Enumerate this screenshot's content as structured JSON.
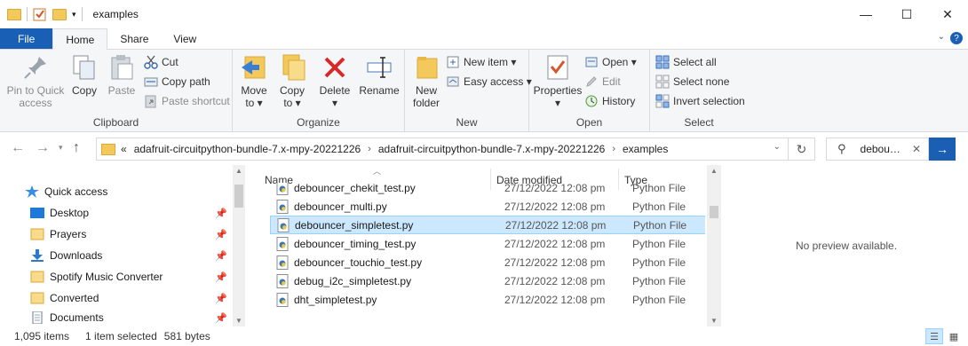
{
  "window": {
    "title": "examples",
    "controls": {
      "minimize": "—",
      "maximize": "☐",
      "close": "✕"
    }
  },
  "tabs": [
    {
      "label": "File"
    },
    {
      "label": "Home"
    },
    {
      "label": "Share"
    },
    {
      "label": "View"
    }
  ],
  "ribbon": {
    "clipboard": {
      "label": "Clipboard",
      "pin": [
        "Pin to Quick",
        "access"
      ],
      "copy": "Copy",
      "paste": "Paste",
      "cut": "Cut",
      "copy_path": "Copy path",
      "paste_shortcut": "Paste shortcut"
    },
    "organize": {
      "label": "Organize",
      "move": [
        "Move",
        "to ▾"
      ],
      "copy": [
        "Copy",
        "to ▾"
      ],
      "delete": [
        "Delete",
        "▾"
      ],
      "rename": "Rename"
    },
    "new": {
      "label": "New",
      "folder": [
        "New",
        "folder"
      ],
      "new_item": "New item ▾",
      "easy_access": "Easy access ▾"
    },
    "open": {
      "label": "Open",
      "properties": [
        "Properties",
        "▾"
      ],
      "open": "Open ▾",
      "edit": "Edit",
      "history": "History"
    },
    "select": {
      "label": "Select",
      "select_all": "Select all",
      "select_none": "Select none",
      "invert": "Invert selection"
    }
  },
  "address": {
    "prefix": "«",
    "crumbs": [
      "adafruit-circuitpython-bundle-7.x-mpy-20221226",
      "adafruit-circuitpython-bundle-7.x-mpy-20221226",
      "examples"
    ],
    "search_text": "debou…"
  },
  "nav": {
    "items": [
      {
        "label": "Quick access",
        "icon": "star-icon"
      },
      {
        "label": "Desktop",
        "icon": "desktop-icon"
      },
      {
        "label": "Prayers",
        "icon": "folder-icon"
      },
      {
        "label": "Downloads",
        "icon": "download-icon"
      },
      {
        "label": "Spotify Music Converter",
        "icon": "folder-icon"
      },
      {
        "label": "Converted",
        "icon": "folder-icon"
      },
      {
        "label": "Documents",
        "icon": "documents-icon"
      }
    ]
  },
  "columns": {
    "name": "Name",
    "date": "Date modified",
    "type": "Type"
  },
  "files": [
    {
      "name": "debouncer_chekit_test.py",
      "date": "27/12/2022 12:08 pm",
      "type": "Python File"
    },
    {
      "name": "debouncer_multi.py",
      "date": "27/12/2022 12:08 pm",
      "type": "Python File"
    },
    {
      "name": "debouncer_simpletest.py",
      "date": "27/12/2022 12:08 pm",
      "type": "Python File"
    },
    {
      "name": "debouncer_timing_test.py",
      "date": "27/12/2022 12:08 pm",
      "type": "Python File"
    },
    {
      "name": "debouncer_touchio_test.py",
      "date": "27/12/2022 12:08 pm",
      "type": "Python File"
    },
    {
      "name": "debug_i2c_simpletest.py",
      "date": "27/12/2022 12:08 pm",
      "type": "Python File"
    },
    {
      "name": "dht_simpletest.py",
      "date": "27/12/2022 12:08 pm",
      "type": "Python File"
    }
  ],
  "preview": {
    "message": "No preview available."
  },
  "status": {
    "count": "1,095 items",
    "selected": "1 item selected",
    "size": "581 bytes"
  },
  "colors": {
    "accent": "#1a5fb4",
    "selection": "#cce8ff",
    "folder": "#f3c95b"
  }
}
